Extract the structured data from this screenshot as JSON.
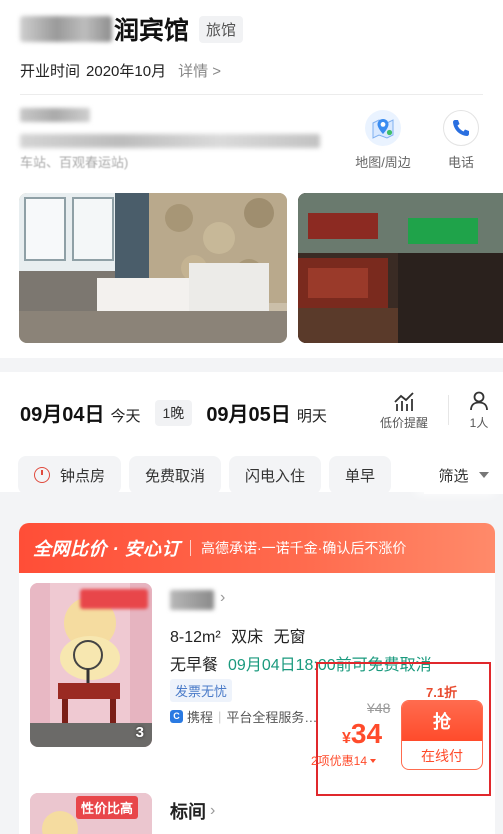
{
  "hotel": {
    "name_suffix": "润宾馆",
    "type_tag": "旅馆",
    "opening_label": "开业时间",
    "opening_value": "2020年10月",
    "details_link": "详情 >",
    "address_tail": "车站、百观春运站)",
    "actions": {
      "map_label": "地图/周边",
      "phone_label": "电话"
    }
  },
  "booking": {
    "checkin_date": "09月04日",
    "checkin_day": "今天",
    "nights": "1晚",
    "checkout_date": "09月05日",
    "checkout_day": "明天",
    "low_price_alert": "低价提醒",
    "guests": "1人"
  },
  "filters": {
    "chips": [
      "钟点房",
      "免费取消",
      "闪电入住",
      "单早"
    ],
    "filter_label": "筛选"
  },
  "banner": {
    "title": "全网比价 · 安心订",
    "subtitle": "高德承诺·一诺千金·确认后不涨价"
  },
  "room": {
    "spec": "8-12m² 双床 无窗",
    "meal": "无早餐",
    "cancel_policy": "09月04日18:00前可免费取消",
    "badge": "发票无忧",
    "source": "携程",
    "source_note": "平台全程服务…",
    "photo_count": "3",
    "discount": "7.1折",
    "original_price": "¥48",
    "currency": "¥",
    "price": "34",
    "promo": "2项优惠14",
    "grab_label": "抢",
    "pay_label": "在线付"
  },
  "room2": {
    "tag": "性价比高",
    "name": "标间"
  },
  "colors": {
    "accent": "#ff4b2b",
    "cancel_green": "#1a9a7e",
    "highlight_box": "#e0282c"
  }
}
